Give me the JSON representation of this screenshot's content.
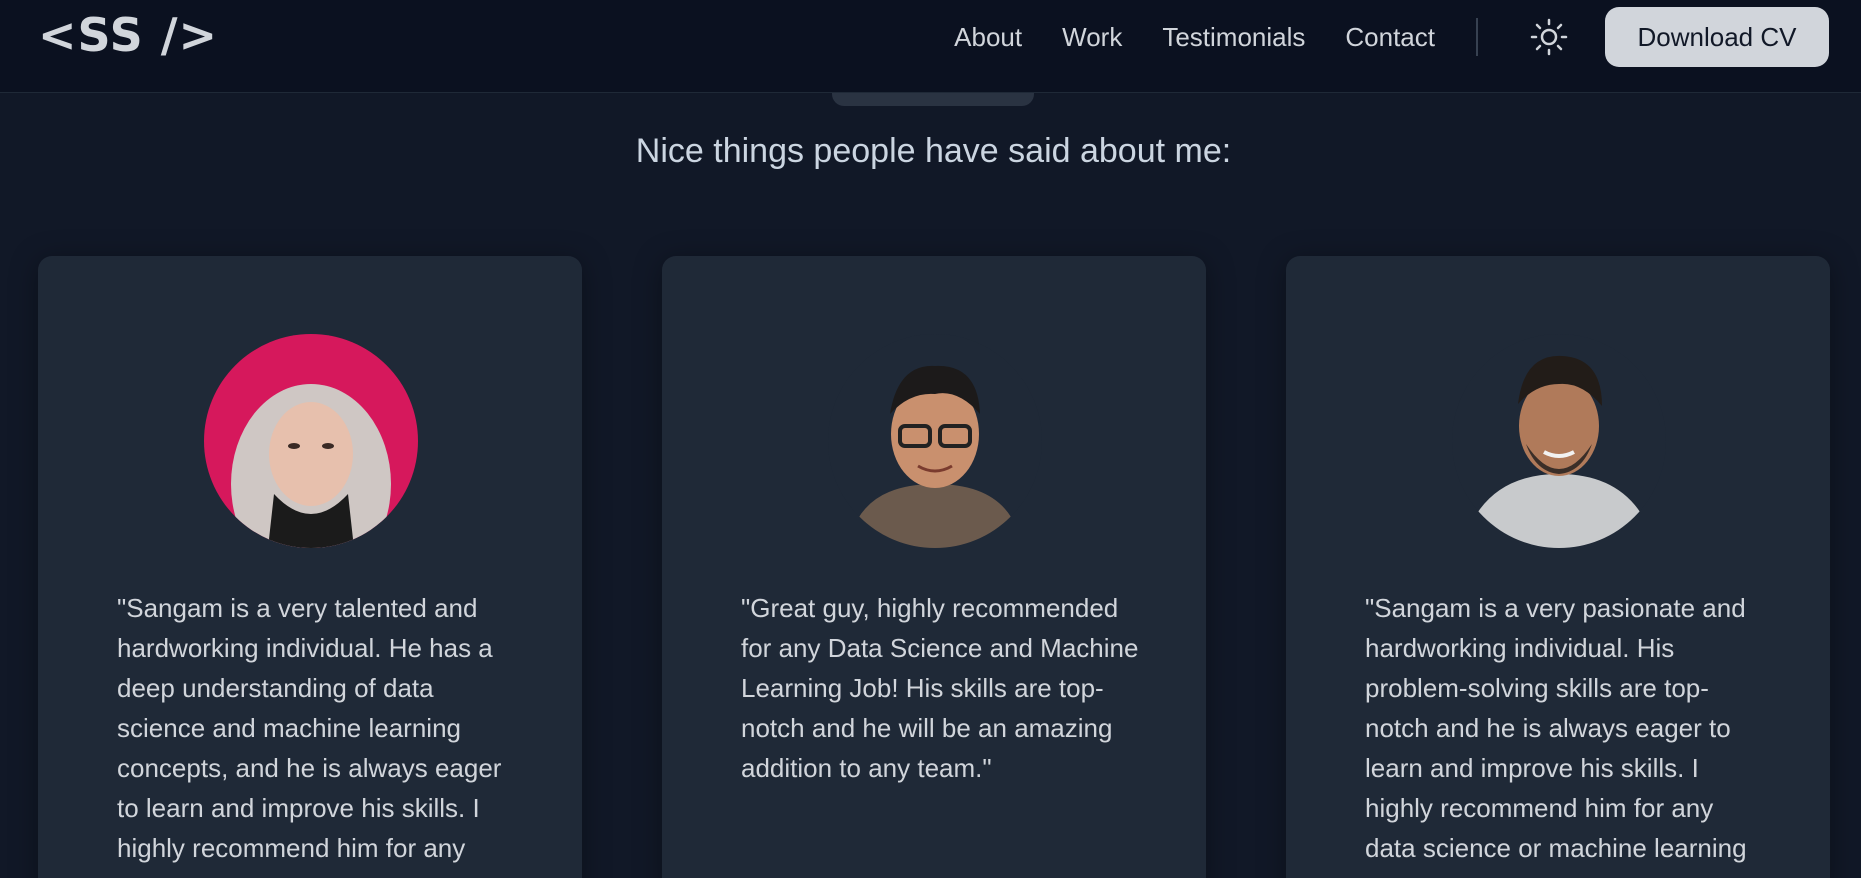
{
  "header": {
    "logo": "<SS />",
    "nav": [
      "About",
      "Work",
      "Testimonials",
      "Contact"
    ],
    "theme_icon": "sun-icon",
    "download_label": "Download CV"
  },
  "testimonials": {
    "subtitle": "Nice things people have said about me:",
    "cards": [
      {
        "quote": "\"Sangam is a very talented and hardworking individual. He has a deep understanding of data science and machine learning concepts, and he is always eager to learn and improve his skills. I highly recommend him for any data science or"
      },
      {
        "quote": "\"Great guy, highly recommended for any Data Science and Machine Learning Job! His skills are top-notch and he will be an amazing addition to any team.\""
      },
      {
        "quote": "\"Sangam is a very pasionate and hardworking individual. His problem-solving skills are top-notch and he is always eager to learn and improve his skills. I highly recommend him for any data science or machine learning role.\""
      }
    ]
  },
  "colors": {
    "background": "#111827",
    "header": "#0b1120",
    "card": "#1f2937",
    "text": "#d1d5db",
    "button": "#d1d5db"
  }
}
